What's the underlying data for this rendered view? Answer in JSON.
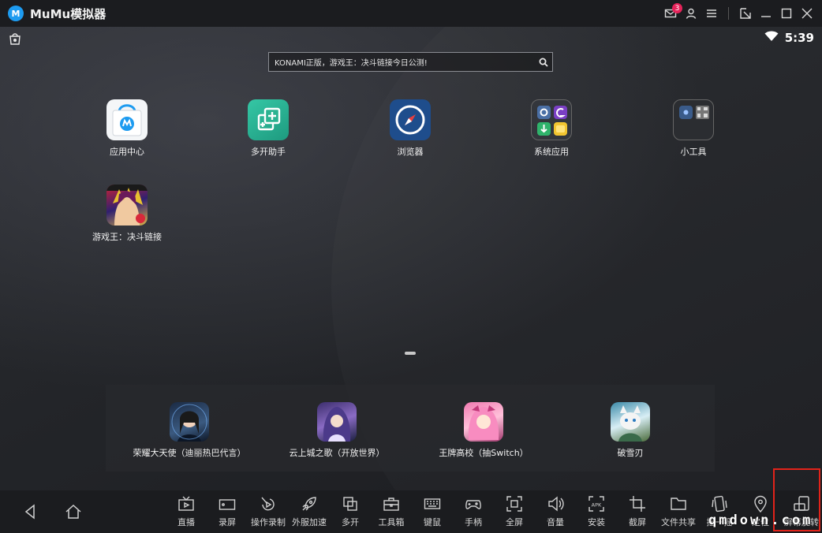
{
  "window": {
    "title": "MuMu模拟器",
    "notification_count": "3"
  },
  "status": {
    "time": "5:39"
  },
  "search": {
    "text": "KONAMI正版，游戏王：决斗链接今日公测!"
  },
  "apps": [
    {
      "label": "应用中心"
    },
    {
      "label": "多开助手"
    },
    {
      "label": "浏览器"
    },
    {
      "label": "系统应用"
    },
    {
      "label": "小工具"
    },
    {
      "label": "游戏王：决斗链接"
    }
  ],
  "dock": [
    {
      "label": "荣耀大天使（迪丽热巴代言）"
    },
    {
      "label": "云上城之歌（开放世界）"
    },
    {
      "label": "王牌高校（抽Switch）"
    },
    {
      "label": "破雪刃"
    }
  ],
  "toolbar": [
    {
      "label": "直播",
      "icon": "tv-icon"
    },
    {
      "label": "录屏",
      "icon": "video-camera-icon"
    },
    {
      "label": "操作录制",
      "icon": "macro-record-icon"
    },
    {
      "label": "外服加速",
      "icon": "rocket-icon"
    },
    {
      "label": "多开",
      "icon": "multi-window-icon"
    },
    {
      "label": "工具箱",
      "icon": "toolbox-icon"
    },
    {
      "label": "键鼠",
      "icon": "keyboard-icon"
    },
    {
      "label": "手柄",
      "icon": "gamepad-icon"
    },
    {
      "label": "全屏",
      "icon": "fullscreen-icon"
    },
    {
      "label": "音量",
      "icon": "volume-icon"
    },
    {
      "label": "安装",
      "icon": "apk-install-icon"
    },
    {
      "label": "截屏",
      "icon": "crop-icon"
    },
    {
      "label": "文件共享",
      "icon": "folder-icon"
    },
    {
      "label": "摇一摇",
      "icon": "shake-icon"
    },
    {
      "label": "定位",
      "icon": "location-pin-icon"
    },
    {
      "label": "屏幕旋转",
      "icon": "rotate-screen-icon"
    }
  ],
  "watermark": "qmdown.com"
}
